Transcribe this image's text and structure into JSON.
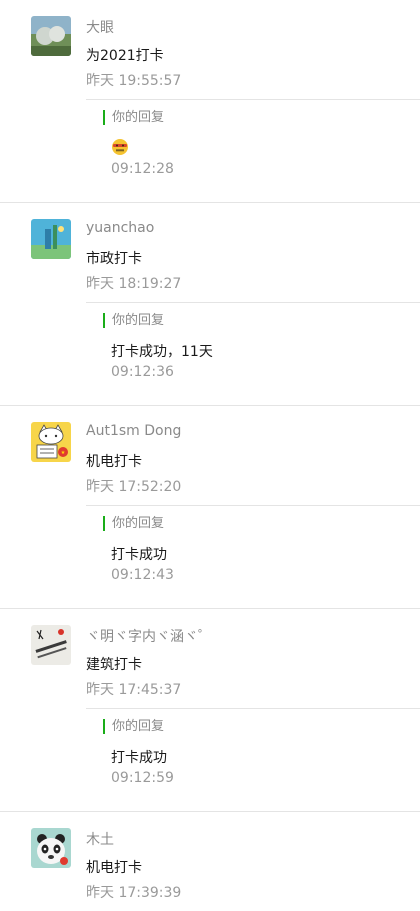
{
  "comments": [
    {
      "name": "大眼",
      "message": "为2021打卡",
      "time": "昨天 19:55:57",
      "reply": {
        "label": "你的回复",
        "text": "",
        "emoji": "zipper-mouth-face-icon",
        "time": "09:12:28"
      }
    },
    {
      "name": "yuanchao",
      "message": "市政打卡",
      "time": "昨天 18:19:27",
      "reply": {
        "label": "你的回复",
        "text": "打卡成功，11天",
        "time": "09:12:36"
      }
    },
    {
      "name": "Aut1sm Dong",
      "message": "机电打卡",
      "time": "昨天 17:52:20",
      "reply": {
        "label": "你的回复",
        "text": "打卡成功",
        "time": "09:12:43"
      }
    },
    {
      "name": "ヾ明ヾ字内ヾ涵ヾ゜",
      "message": "建筑打卡",
      "time": "昨天 17:45:37",
      "reply": {
        "label": "你的回复",
        "text": "打卡成功",
        "time": "09:12:59"
      }
    },
    {
      "name": "木土",
      "message": "机电打卡",
      "time": "昨天 17:39:39"
    }
  ],
  "colors": {
    "accent": "#1aad19",
    "divider": "#e4e4e4",
    "secondary_text": "#8a8a8a",
    "primary_text": "#1a1a1a"
  }
}
